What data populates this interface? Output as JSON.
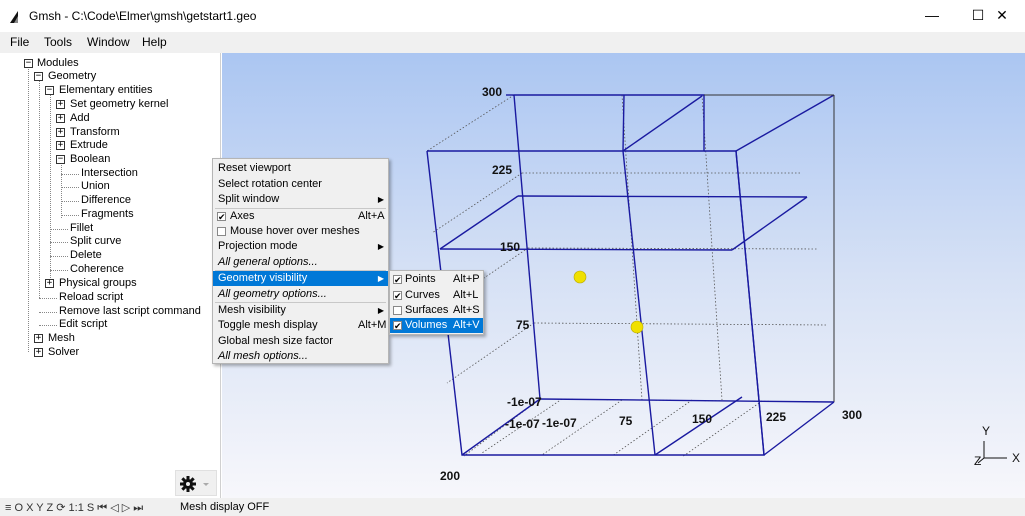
{
  "window": {
    "title": "Gmsh - C:\\Code\\Elmer\\gmsh\\getstart1.geo",
    "minimize": "—",
    "maximize": "☐",
    "close": "✕"
  },
  "menubar": {
    "items": [
      {
        "label": "File"
      },
      {
        "label": "Tools"
      },
      {
        "label": "Window"
      },
      {
        "label": "Help"
      }
    ]
  },
  "tree": {
    "items": [
      {
        "label": "Modules",
        "toggle": "−"
      },
      {
        "label": "Geometry",
        "toggle": "−"
      },
      {
        "label": "Elementary entities",
        "toggle": "−"
      },
      {
        "label": "Set geometry kernel",
        "toggle": "+"
      },
      {
        "label": "Add",
        "toggle": "+"
      },
      {
        "label": "Transform",
        "toggle": "+"
      },
      {
        "label": "Extrude",
        "toggle": "+"
      },
      {
        "label": "Boolean",
        "toggle": "−"
      },
      {
        "label": "Intersection"
      },
      {
        "label": "Union"
      },
      {
        "label": "Difference"
      },
      {
        "label": "Fragments"
      },
      {
        "label": "Fillet"
      },
      {
        "label": "Split curve"
      },
      {
        "label": "Delete"
      },
      {
        "label": "Coherence"
      },
      {
        "label": "Physical groups",
        "toggle": "+"
      },
      {
        "label": "Reload script"
      },
      {
        "label": "Remove last script command"
      },
      {
        "label": "Edit script"
      },
      {
        "label": "Mesh",
        "toggle": "+"
      },
      {
        "label": "Solver",
        "toggle": "+"
      }
    ]
  },
  "context_menu": {
    "items": [
      {
        "label": "Reset viewport"
      },
      {
        "label": "Select rotation center"
      },
      {
        "label": "Split window",
        "submenu": "▶"
      },
      {
        "label": "Axes",
        "shortcut": "Alt+A",
        "check": "✔"
      },
      {
        "label": "Mouse hover over meshes",
        "check": ""
      },
      {
        "label": "Projection mode",
        "submenu": "▶"
      },
      {
        "label": "All general options..."
      },
      {
        "label": "Geometry visibility",
        "submenu": "▶"
      },
      {
        "label": "All geometry options..."
      },
      {
        "label": "Mesh visibility",
        "submenu": "▶"
      },
      {
        "label": "Toggle mesh display",
        "shortcut": "Alt+M"
      },
      {
        "label": "Global mesh size factor"
      },
      {
        "label": "All mesh options..."
      }
    ]
  },
  "submenu": {
    "items": [
      {
        "label": "Points",
        "shortcut": "Alt+P",
        "check": "✔"
      },
      {
        "label": "Curves",
        "shortcut": "Alt+L",
        "check": "✔"
      },
      {
        "label": "Surfaces",
        "shortcut": "Alt+S",
        "check": ""
      },
      {
        "label": "Volumes",
        "shortcut": "Alt+V",
        "check": "✔"
      }
    ]
  },
  "viewport": {
    "axis_labels": [
      "300",
      "225",
      "150",
      "75",
      "-1e-07",
      "-1e-07",
      "-1e-07",
      "75",
      "150",
      "225",
      "300",
      "200"
    ],
    "triad": {
      "y": "Y",
      "z": "Z",
      "x": "X"
    }
  },
  "statusbar": {
    "icons": "≡ O X Y Z ⟳ 1:1 S ⏮ ◁ ▷ ⏭",
    "message": "Mesh display OFF"
  },
  "colors": {
    "selection": "#0078d7",
    "edge_blue": "#1a1aa0",
    "point_yellow": "#f0e000"
  }
}
